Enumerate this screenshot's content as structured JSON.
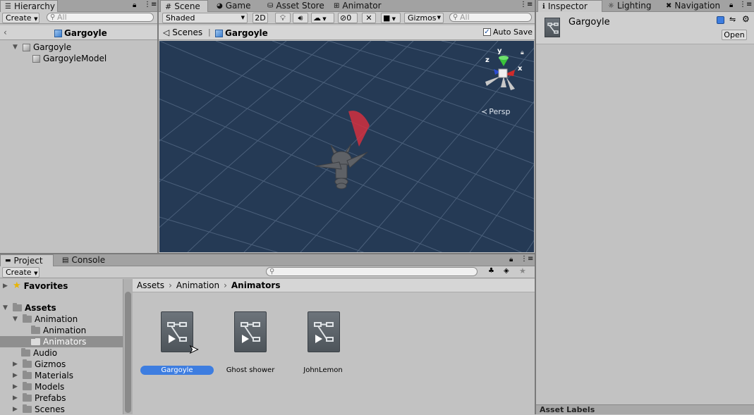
{
  "hierarchy": {
    "tab_label": "Hierarchy",
    "create_label": "Create",
    "search_placeholder": "All",
    "scene_title": "Gargoyle",
    "items": [
      {
        "label": "Gargoyle"
      },
      {
        "label": "GargoyleModel"
      }
    ]
  },
  "scene_tabs": [
    {
      "label": "Scene"
    },
    {
      "label": "Game"
    },
    {
      "label": "Asset Store"
    },
    {
      "label": "Animator"
    }
  ],
  "scene_toolbar": {
    "shading_mode": "Shaded",
    "mode_2d": "2D",
    "hidden_count": "0",
    "gizmos_label": "Gizmos",
    "search_placeholder": "All"
  },
  "scene_breadcrumb": {
    "scenes_label": "Scenes",
    "current": "Gargoyle",
    "auto_save_label": "Auto Save",
    "auto_save_checked": true
  },
  "scene_view": {
    "persp_label": "Persp",
    "axis_x": "x",
    "axis_y": "y",
    "axis_z": "z"
  },
  "inspector": {
    "tabs": [
      {
        "label": "Inspector"
      },
      {
        "label": "Lighting"
      },
      {
        "label": "Navigation"
      }
    ],
    "object_name": "Gargoyle",
    "open_button": "Open",
    "asset_labels": "Asset Labels"
  },
  "project": {
    "tabs": [
      {
        "label": "Project"
      },
      {
        "label": "Console"
      }
    ],
    "create_label": "Create",
    "favorites_label": "Favorites",
    "assets_label": "Assets",
    "tree": [
      {
        "label": "Animation"
      },
      {
        "label": "Animation"
      },
      {
        "label": "Animators"
      },
      {
        "label": "Audio"
      },
      {
        "label": "Gizmos"
      },
      {
        "label": "Materials"
      },
      {
        "label": "Models"
      },
      {
        "label": "Prefabs"
      },
      {
        "label": "Scenes"
      }
    ],
    "breadcrumb": [
      "Assets",
      "Animation",
      "Animators"
    ],
    "assets": [
      {
        "label": "Gargoyle",
        "selected": true
      },
      {
        "label": "Ghost shower",
        "selected": false
      },
      {
        "label": "JohnLemon",
        "selected": false
      }
    ]
  },
  "colors": {
    "scene_bg": "#253a55",
    "selection": "#3d7de0",
    "panel": "#c2c2c2"
  }
}
